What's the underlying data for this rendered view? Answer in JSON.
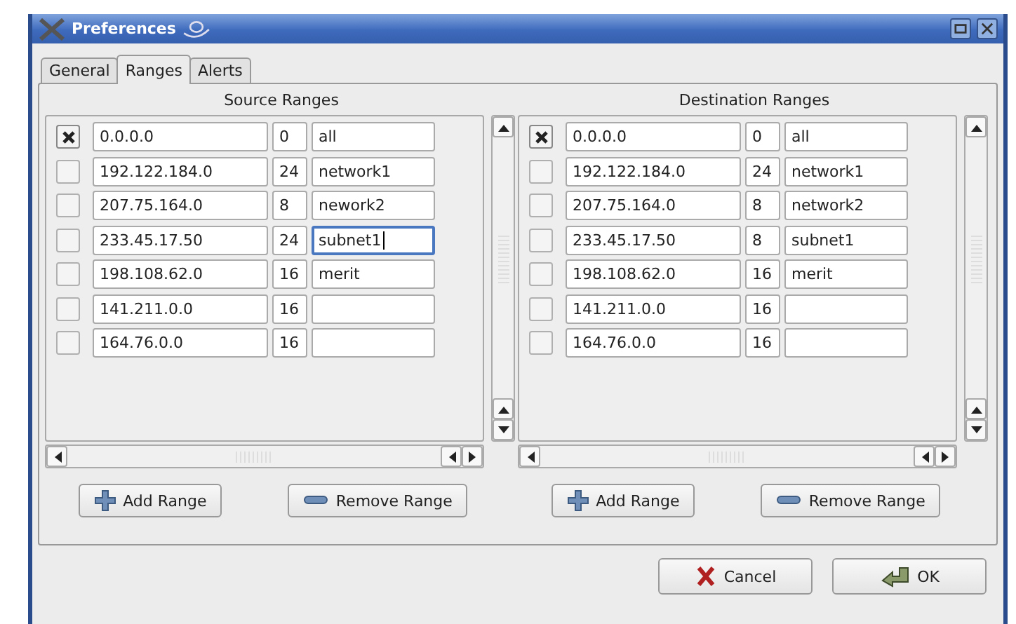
{
  "window": {
    "title": "Preferences"
  },
  "tabs": [
    {
      "label": "General",
      "selected": false
    },
    {
      "label": "Ranges",
      "selected": true
    },
    {
      "label": "Alerts",
      "selected": false
    }
  ],
  "panels": [
    {
      "title": "Source Ranges",
      "rows": [
        {
          "checked": true,
          "address": "0.0.0.0",
          "prefix": "0",
          "name": "all",
          "focused": false
        },
        {
          "checked": false,
          "address": "192.122.184.0",
          "prefix": "24",
          "name": "network1",
          "focused": false
        },
        {
          "checked": false,
          "address": "207.75.164.0",
          "prefix": "8",
          "name": "nework2",
          "focused": false
        },
        {
          "checked": false,
          "address": "233.45.17.50",
          "prefix": "24",
          "name": "subnet1",
          "focused": true
        },
        {
          "checked": false,
          "address": "198.108.62.0",
          "prefix": "16",
          "name": "merit",
          "focused": false
        },
        {
          "checked": false,
          "address": "141.211.0.0",
          "prefix": "16",
          "focused": false
        },
        {
          "checked": false,
          "address": "164.76.0.0",
          "prefix": "16",
          "focused": false
        }
      ],
      "buttons": [
        {
          "kind": "add",
          "label": "Add Range"
        },
        {
          "kind": "remove",
          "label": "Remove Range"
        }
      ]
    },
    {
      "title": "Destination Ranges",
      "rows": [
        {
          "checked": true,
          "address": "0.0.0.0",
          "prefix": "0",
          "name": "all",
          "focused": false
        },
        {
          "checked": false,
          "address": "192.122.184.0",
          "prefix": "24",
          "name": "network1",
          "focused": false
        },
        {
          "checked": false,
          "address": "207.75.164.0",
          "prefix": "8",
          "name": "network2",
          "focused": false
        },
        {
          "checked": false,
          "address": "233.45.17.50",
          "prefix": "8",
          "name": "subnet1",
          "focused": false
        },
        {
          "checked": false,
          "address": "198.108.62.0",
          "prefix": "16",
          "name": "merit",
          "focused": false
        },
        {
          "checked": false,
          "address": "141.211.0.0",
          "prefix": "16",
          "focused": false
        },
        {
          "checked": false,
          "address": "164.76.0.0",
          "prefix": "16",
          "focused": false
        }
      ],
      "buttons": [
        {
          "kind": "add",
          "label": "Add Range"
        },
        {
          "kind": "remove",
          "label": "Remove Range"
        }
      ]
    }
  ],
  "dialog_buttons": [
    {
      "kind": "cancel",
      "label": "Cancel"
    },
    {
      "kind": "ok",
      "label": "OK"
    }
  ]
}
